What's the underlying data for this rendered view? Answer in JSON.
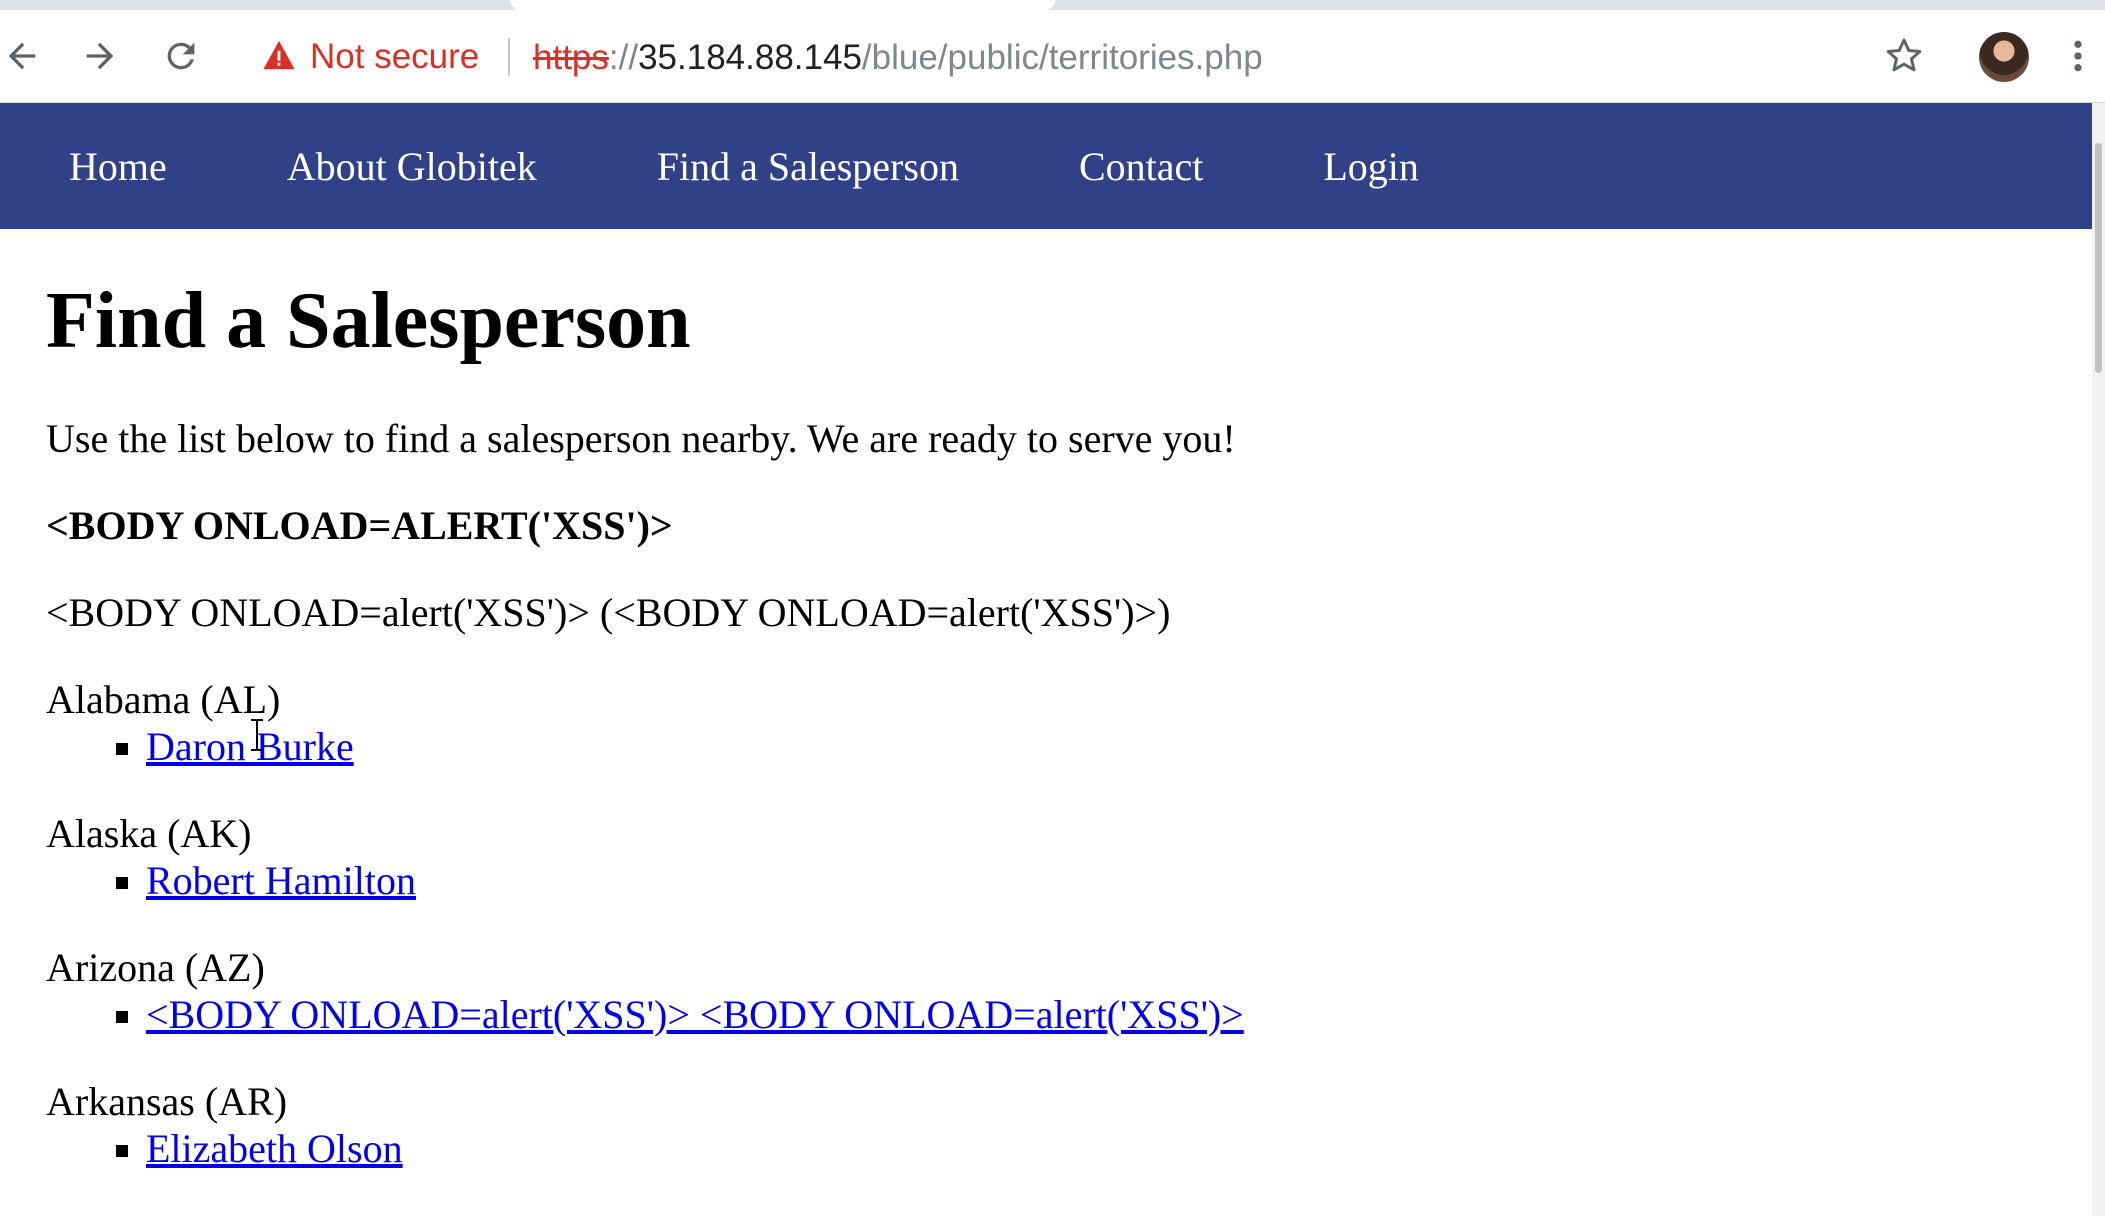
{
  "browser": {
    "security_label": "Not secure",
    "url_scheme": "https",
    "url_separator": "://",
    "url_host": "35.184.88.145",
    "url_path": "/blue/public/territories.php",
    "icons": [
      "back-arrow-icon",
      "forward-arrow-icon",
      "reload-icon",
      "warning-triangle-icon",
      "star-icon",
      "avatar",
      "kebab-menu-icon"
    ],
    "colors": {
      "insecure": "#d93025"
    }
  },
  "nav": {
    "items": [
      {
        "label": "Home"
      },
      {
        "label": "About Globitek"
      },
      {
        "label": "Find a Salesperson"
      },
      {
        "label": "Contact"
      },
      {
        "label": "Login"
      }
    ],
    "color": "#314188"
  },
  "main": {
    "title": "Find a Salesperson",
    "intro": "Use the list below to find a salesperson nearby. We are ready to serve you!",
    "bold_line": "<BODY ONLOAD=ALERT('XSS')>",
    "plain_line": "<BODY ONLOAD=alert('XSS')> (<BODY ONLOAD=alert('XSS')>)",
    "territories": [
      {
        "name": "Alabama (AL)",
        "salespeople": [
          "Daron Burke"
        ]
      },
      {
        "name": "Alaska (AK)",
        "salespeople": [
          "Robert Hamilton"
        ]
      },
      {
        "name": "Arizona (AZ)",
        "salespeople": [
          "<BODY ONLOAD=alert('XSS')> <BODY ONLOAD=alert('XSS')>"
        ]
      },
      {
        "name": "Arkansas (AR)",
        "salespeople": [
          "Elizabeth Olson"
        ]
      }
    ],
    "link_color": "#0000ee"
  }
}
